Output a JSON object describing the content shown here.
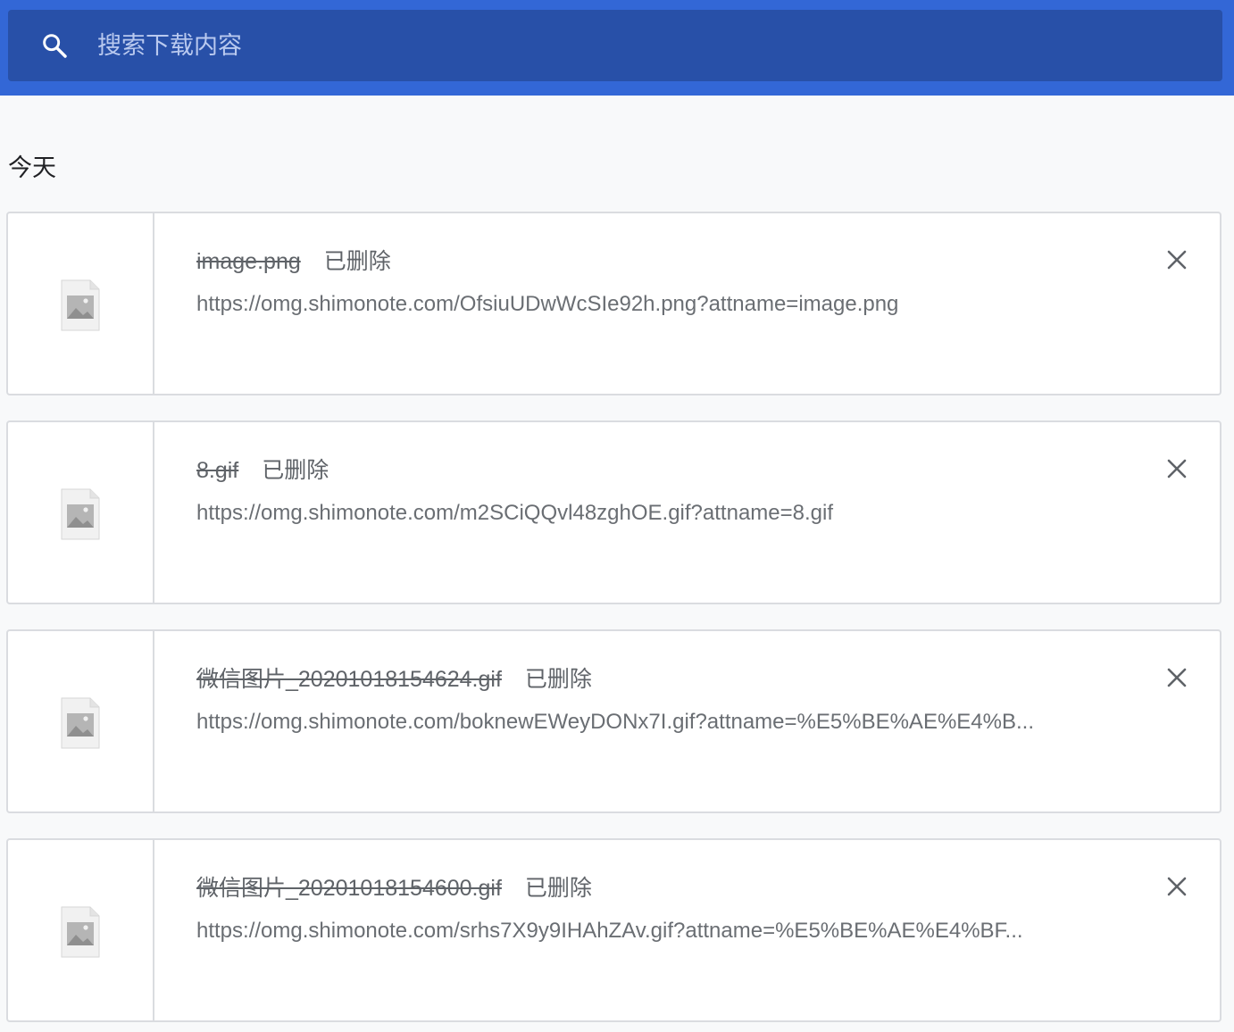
{
  "search": {
    "placeholder": "搜索下载内容",
    "icon": "search-icon"
  },
  "section": {
    "title": "今天"
  },
  "colors": {
    "header": "#3367d6",
    "search_box": "#2850a8",
    "background": "#f8f9fa"
  },
  "downloads": [
    {
      "file_name": "image.png",
      "status": "已删除",
      "url": "https://omg.shimonote.com/OfsiuUDwWcSIe92h.png?attname=image.png",
      "icon": "image-file-icon"
    },
    {
      "file_name": "8.gif",
      "status": "已删除",
      "url": "https://omg.shimonote.com/m2SCiQQvl48zghOE.gif?attname=8.gif",
      "icon": "image-file-icon"
    },
    {
      "file_name": "微信图片_20201018154624.gif",
      "status": "已删除",
      "url": "https://omg.shimonote.com/boknewEWeyDONx7I.gif?attname=%E5%BE%AE%E4%B...",
      "icon": "image-file-icon"
    },
    {
      "file_name": "微信图片_20201018154600.gif",
      "status": "已删除",
      "url": "https://omg.shimonote.com/srhs7X9y9IHAhZAv.gif?attname=%E5%BE%AE%E4%BF...",
      "icon": "image-file-icon"
    }
  ]
}
